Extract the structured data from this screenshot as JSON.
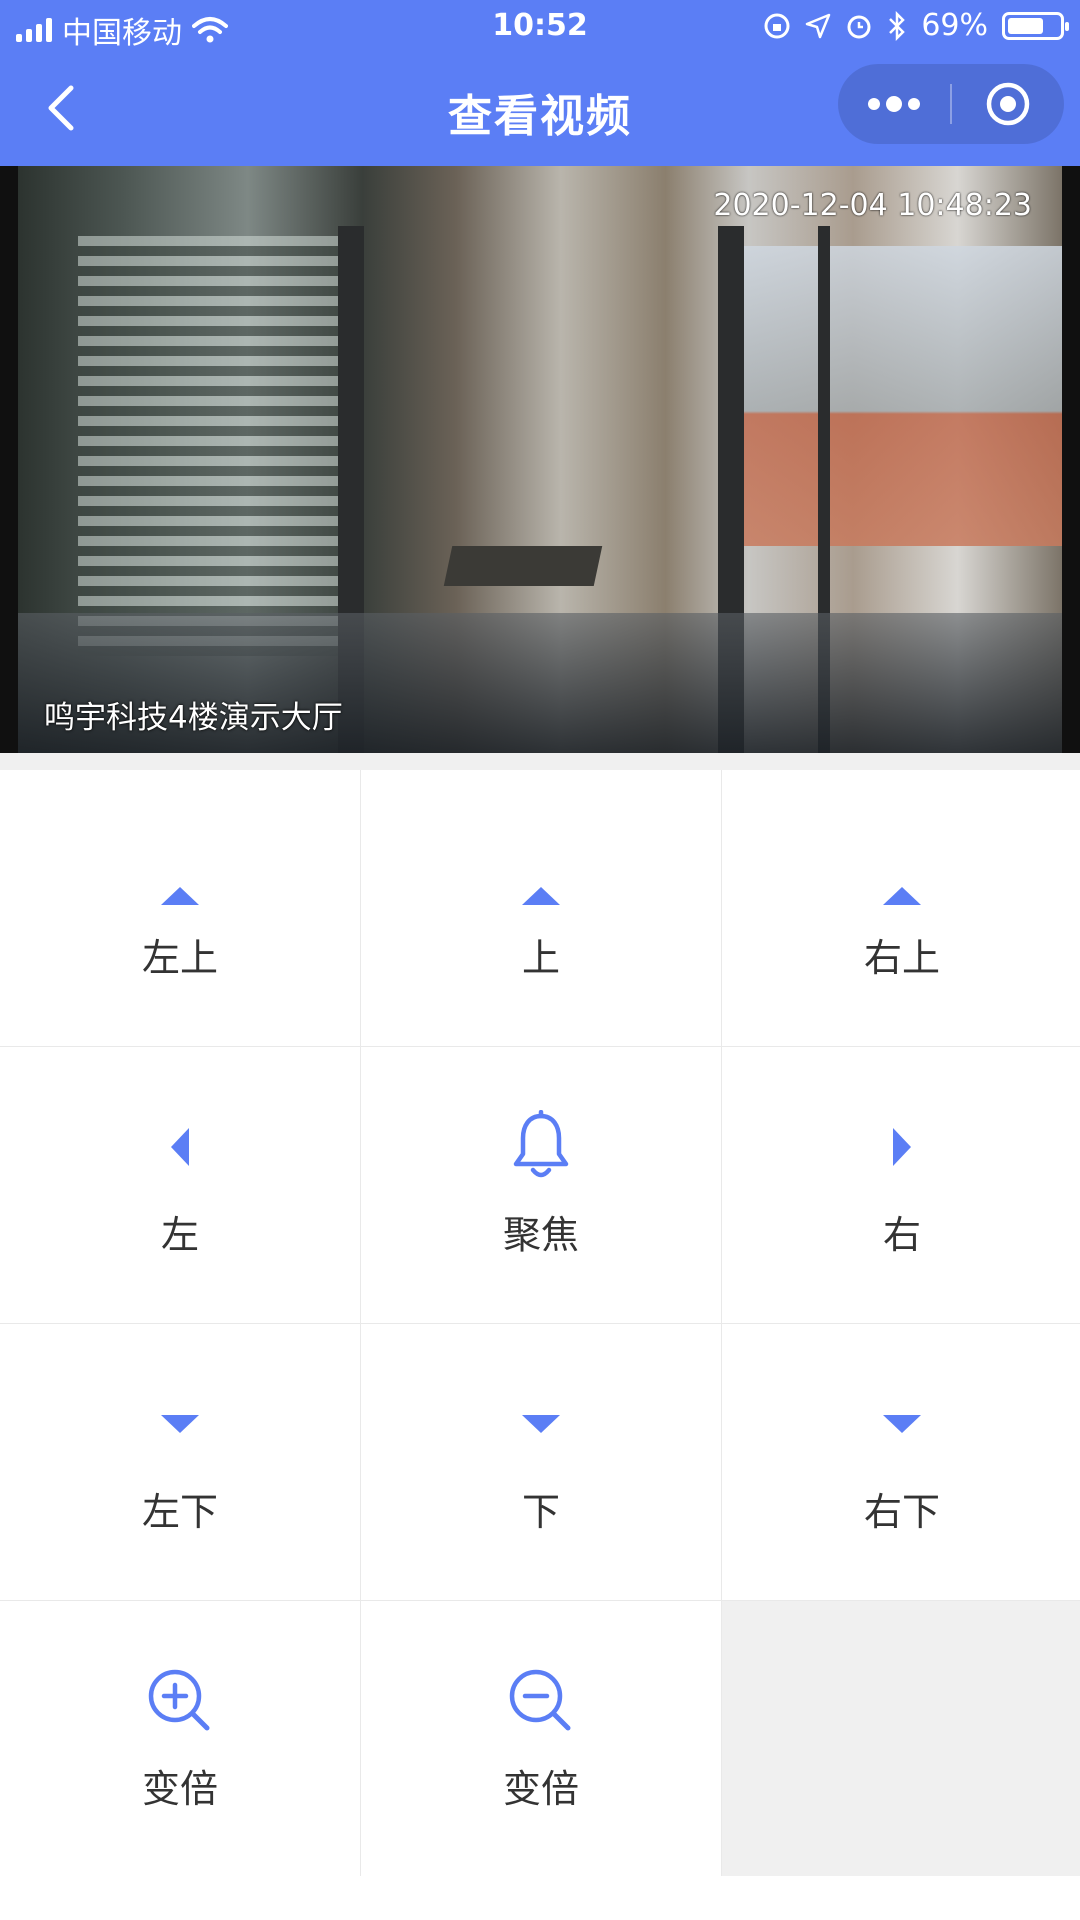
{
  "status_bar": {
    "carrier": "中国移动",
    "time": "10:52",
    "battery": "69%",
    "battery_level": 0.69
  },
  "nav": {
    "title": "查看视频",
    "back_icon": "chevron-left-icon",
    "more_icon": "more-dots-icon",
    "close_icon": "target-circle-icon"
  },
  "video": {
    "timestamp": "2020-12-04 10:48:23",
    "camera_label": "鸣宇科技4楼演示大厅"
  },
  "controls": [
    {
      "label": "左上",
      "icon": "arrow-up-icon"
    },
    {
      "label": "上",
      "icon": "arrow-up-icon"
    },
    {
      "label": "右上",
      "icon": "arrow-up-icon"
    },
    {
      "label": "左",
      "icon": "arrow-left-icon"
    },
    {
      "label": "聚焦",
      "icon": "bell-icon"
    },
    {
      "label": "右",
      "icon": "arrow-right-icon"
    },
    {
      "label": "左下",
      "icon": "arrow-down-icon"
    },
    {
      "label": "下",
      "icon": "arrow-down-icon"
    },
    {
      "label": "右下",
      "icon": "arrow-down-icon"
    },
    {
      "label": "变倍",
      "icon": "zoom-in-icon"
    },
    {
      "label": "变倍",
      "icon": "zoom-out-icon"
    }
  ],
  "colors": {
    "accent": "#5b7ef5",
    "background": "#f0f0f0"
  }
}
